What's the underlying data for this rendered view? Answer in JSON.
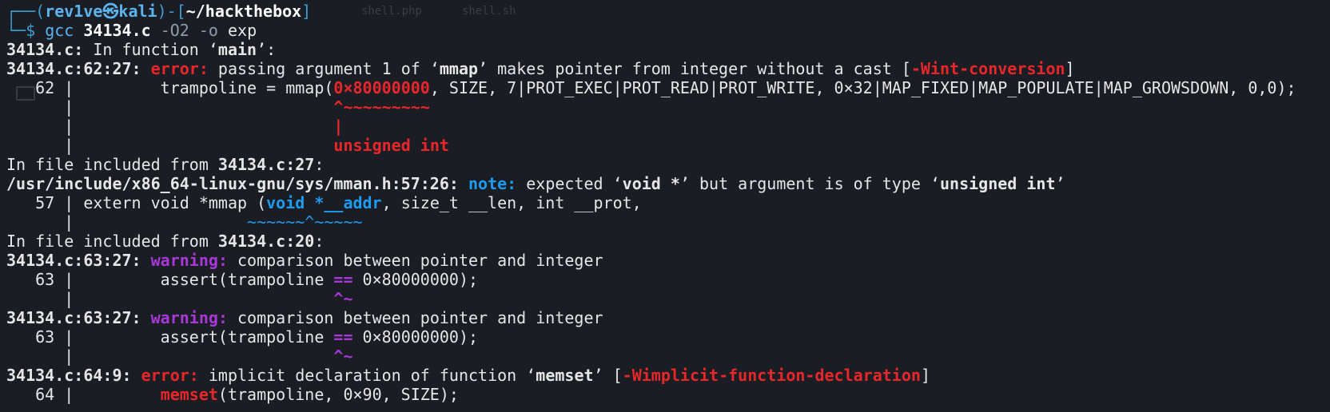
{
  "ghost_tabs": [
    "shell.php",
    "shell.sh"
  ],
  "prompt": {
    "corner_top": "┌──(",
    "user": "rev1ve",
    "at": "㉿",
    "host": "kali",
    "mid": ")-[",
    "dir": "~/hackthebox",
    "end": "]",
    "corner_bottom": "└─",
    "dollar": "$ ",
    "cmd": "gcc",
    "source": "34134.c",
    "opt": "-O2",
    "out_flag": "-o",
    "out": "exp"
  },
  "lines": [
    [
      {
        "t": "34134.c:",
        "c": "b"
      },
      {
        "t": " In function ‘"
      },
      {
        "t": "main",
        "c": "b"
      },
      {
        "t": "’:"
      }
    ],
    [
      {
        "t": "34134.c:62:27:",
        "c": "b"
      },
      {
        "t": " "
      },
      {
        "t": "error:",
        "c": "redb"
      },
      {
        "t": " passing argument 1 of ‘"
      },
      {
        "t": "mmap",
        "c": "b"
      },
      {
        "t": "’ makes pointer from integer without a cast ["
      },
      {
        "t": "-Wint-conversion",
        "c": "redb"
      },
      {
        "t": "]"
      }
    ],
    [
      {
        "t": "   62 |         trampoline = mmap("
      },
      {
        "t": "0×80000000",
        "c": "redb"
      },
      {
        "t": ", SIZE, 7|PROT_EXEC|PROT_READ|PROT_WRITE, 0×32|MAP_FIXED|MAP_POPULATE|MAP_GROWSDOWN, 0,0);"
      }
    ],
    [
      {
        "t": "      |                           "
      },
      {
        "t": "^~~~~~~~~~",
        "c": "redb"
      }
    ],
    [
      {
        "t": "      |                           "
      },
      {
        "t": "|",
        "c": "redb"
      }
    ],
    [
      {
        "t": "      |                           "
      },
      {
        "t": "unsigned int",
        "c": "redb"
      }
    ],
    [
      {
        "t": "In file included from "
      },
      {
        "t": "34134.c:27",
        "c": "b"
      },
      {
        "t": ":"
      }
    ],
    [
      {
        "t": "/usr/include/x86_64-linux-gnu/sys/mman.h:57:26:",
        "c": "b"
      },
      {
        "t": " "
      },
      {
        "t": "note:",
        "c": "blueb"
      },
      {
        "t": " expected ‘"
      },
      {
        "t": "void *",
        "c": "b"
      },
      {
        "t": "’ but argument is of type ‘"
      },
      {
        "t": "unsigned int",
        "c": "b"
      },
      {
        "t": "’"
      }
    ],
    [
      {
        "t": "   57 | extern void *mmap ("
      },
      {
        "t": "void *__addr",
        "c": "blueb"
      },
      {
        "t": ", size_t __len, int __prot,"
      }
    ],
    [
      {
        "t": "      |                  "
      },
      {
        "t": "~~~~~~^~~~~~",
        "c": "blue"
      }
    ],
    [
      {
        "t": "In file included from "
      },
      {
        "t": "34134.c:20",
        "c": "b"
      },
      {
        "t": ":"
      }
    ],
    [
      {
        "t": "34134.c:63:27:",
        "c": "b"
      },
      {
        "t": " "
      },
      {
        "t": "warning:",
        "c": "magb"
      },
      {
        "t": " comparison between pointer and integer"
      }
    ],
    [
      {
        "t": "   63 |         assert(trampoline "
      },
      {
        "t": "==",
        "c": "magb"
      },
      {
        "t": " 0×80000000);"
      }
    ],
    [
      {
        "t": "      |                           "
      },
      {
        "t": "^~",
        "c": "magb"
      }
    ],
    [
      {
        "t": "34134.c:63:27:",
        "c": "b"
      },
      {
        "t": " "
      },
      {
        "t": "warning:",
        "c": "magb"
      },
      {
        "t": " comparison between pointer and integer"
      }
    ],
    [
      {
        "t": "   63 |         assert(trampoline "
      },
      {
        "t": "==",
        "c": "magb"
      },
      {
        "t": " 0×80000000);"
      }
    ],
    [
      {
        "t": "      |                           "
      },
      {
        "t": "^~",
        "c": "magb"
      }
    ],
    [
      {
        "t": "34134.c:64:9:",
        "c": "b"
      },
      {
        "t": " "
      },
      {
        "t": "error:",
        "c": "redb"
      },
      {
        "t": " implicit declaration of function ‘"
      },
      {
        "t": "memset",
        "c": "b"
      },
      {
        "t": "’ ["
      },
      {
        "t": "-Wimplicit-function-declaration",
        "c": "redb"
      },
      {
        "t": "]"
      }
    ],
    [
      {
        "t": "   64 |         "
      },
      {
        "t": "memset",
        "c": "redb"
      },
      {
        "t": "(trampoline, 0×90, SIZE);"
      }
    ]
  ]
}
